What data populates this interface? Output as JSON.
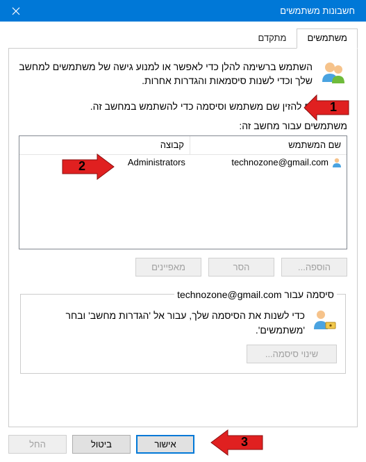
{
  "title": "חשבונות משתמשים",
  "tabs": {
    "users": "משתמשים",
    "advanced": "מתקדם"
  },
  "intro_text": "השתמש ברשימה להלן כדי לאפשר או למנוע גישה של משתמשים למחשב שלך וכדי לשנות סיסמאות והגדרות אחרות.",
  "checkbox_label": "צריכים להזין שם משתמש וסיסמה כדי להשתמש במחשב זה.",
  "list_label": "משתמשים עבור מחשב זה:",
  "columns": {
    "username": "שם המשתמש",
    "group": "קבוצה"
  },
  "rows": [
    {
      "username": "technozone@gmail.com",
      "group": "Administrators"
    }
  ],
  "buttons": {
    "add": "הוספה...",
    "remove": "הסר",
    "properties": "מאפיינים"
  },
  "password_box": {
    "legend_prefix": "סיסמה עבור ",
    "legend_user": "technozone@gmail.com",
    "text": "כדי לשנות את הסיסמה שלך, עבור אל 'הגדרות מחשב' ובחר 'משתמשים'.",
    "btn": "שינוי סיסמה..."
  },
  "dialog_buttons": {
    "ok": "אישור",
    "cancel": "ביטול",
    "apply": "החל"
  },
  "annotations": {
    "one": "1",
    "two": "2",
    "three": "3"
  }
}
